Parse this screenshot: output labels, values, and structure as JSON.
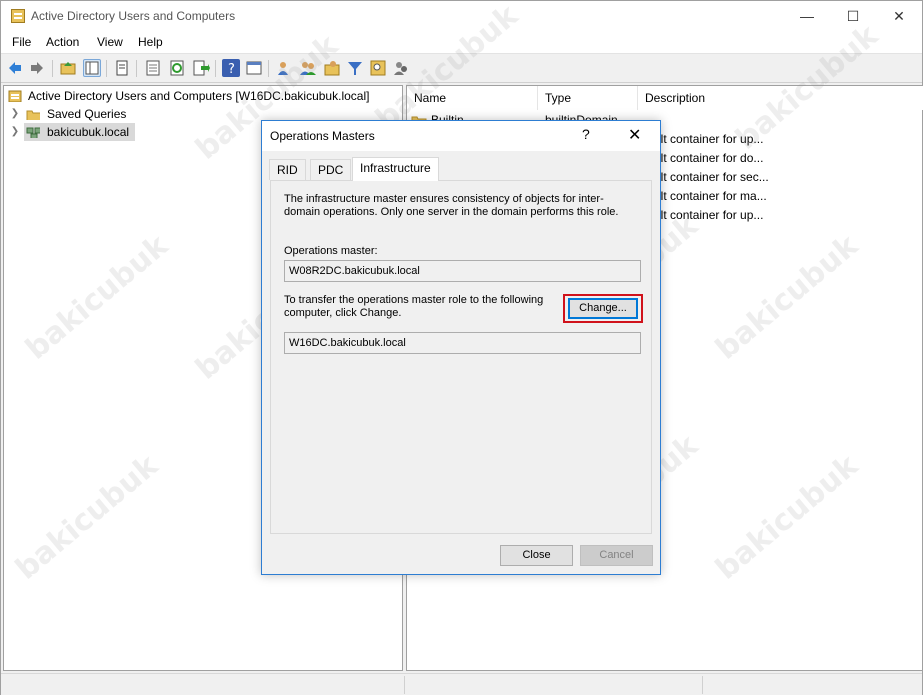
{
  "window": {
    "title": "Active Directory Users and Computers"
  },
  "menu": [
    "File",
    "Action",
    "View",
    "Help"
  ],
  "toolbar_icons": [
    "back-icon",
    "forward-icon",
    "up-folder-icon",
    "show-tree-icon",
    "properties-icon",
    "list-icon",
    "refresh-icon",
    "export-icon",
    "help-icon",
    "view-icon",
    "add-user-icon",
    "add-group-icon",
    "add-ou-icon",
    "filter-icon",
    "find-icon",
    "delegate-icon"
  ],
  "tree": {
    "root": "Active Directory Users and Computers [W16DC.bakicubuk.local]",
    "items": [
      {
        "label": "Saved Queries",
        "icon": "folder-icon"
      },
      {
        "label": "bakicubuk.local",
        "icon": "domain-icon"
      }
    ]
  },
  "list": {
    "columns": [
      "Name",
      "Type",
      "Description"
    ],
    "rows": [
      {
        "name": "Builtin",
        "type": "builtinDomain",
        "description": ""
      },
      {
        "name": "",
        "type": "",
        "description": "fault container for up..."
      },
      {
        "name": "",
        "type": "",
        "description": "fault container for do..."
      },
      {
        "name": "",
        "type": "",
        "description": "fault container for sec..."
      },
      {
        "name": "",
        "type": "",
        "description": "fault container for ma..."
      },
      {
        "name": "",
        "type": "",
        "description": "fault container for up..."
      }
    ]
  },
  "dialog": {
    "title": "Operations Masters",
    "help": "?",
    "close": "✕",
    "tabs": [
      "RID",
      "PDC",
      "Infrastructure"
    ],
    "active_tab": "Infrastructure",
    "description": "The infrastructure master ensures consistency of objects for inter-domain operations. Only one server in the domain performs this role.",
    "operations_master_label": "Operations master:",
    "operations_master_value": "W08R2DC.bakicubuk.local",
    "transfer_text": "To transfer the operations master role to the following computer, click Change.",
    "target_value": "W16DC.bakicubuk.local",
    "change_label": "Change...",
    "close_label": "Close",
    "cancel_label": "Cancel"
  },
  "watermark": "bakicubuk",
  "colors": {
    "accent": "#0078d7",
    "highlight": "#d0121b",
    "folder": "#e8c25a"
  }
}
